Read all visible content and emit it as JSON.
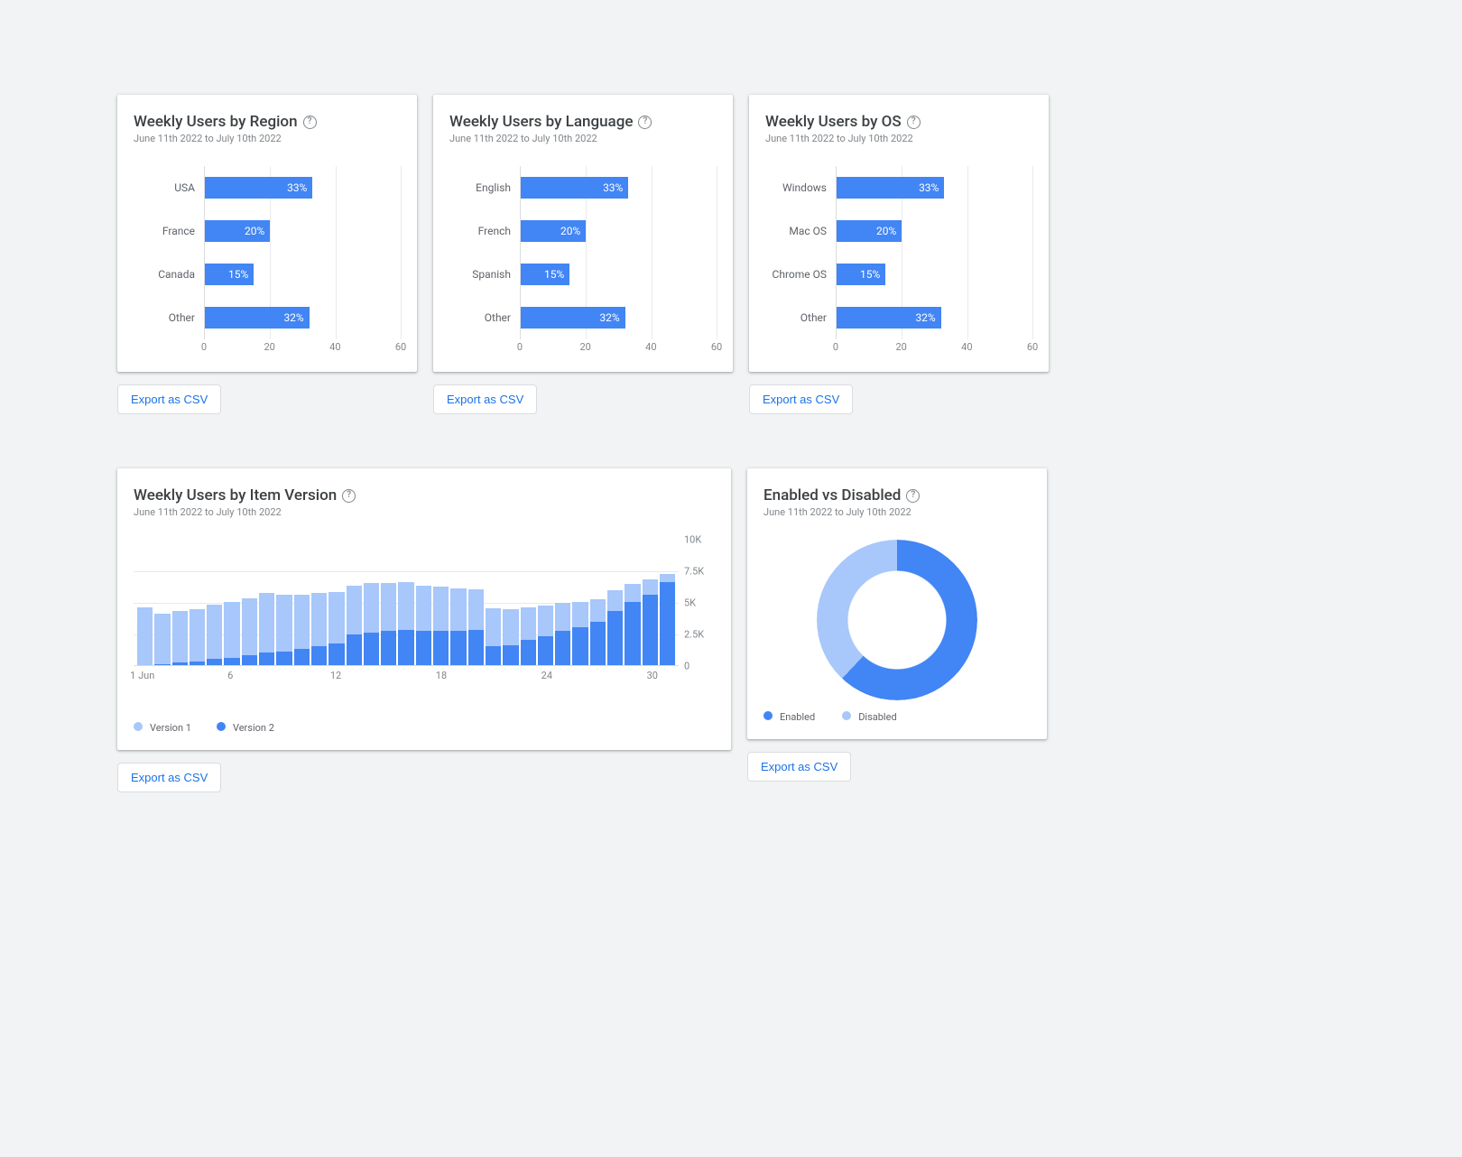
{
  "date_range": "June 11th 2022 to July 10th 2022",
  "export_label": "Export as CSV",
  "cards": {
    "region": {
      "title": "Weekly Users by Region"
    },
    "language": {
      "title": "Weekly Users by Language"
    },
    "os": {
      "title": "Weekly Users by OS"
    },
    "version": {
      "title": "Weekly Users by Item Version"
    },
    "enabled": {
      "title": "Enabled vs Disabled"
    }
  },
  "legend_version": {
    "v1": "Version 1",
    "v2": "Version 2"
  },
  "legend_enabled": {
    "enabled": "Enabled",
    "disabled": "Disabled"
  },
  "chart_data": [
    {
      "id": "region",
      "type": "bar",
      "orientation": "horizontal",
      "title": "Weekly Users by Region",
      "categories": [
        "USA",
        "France",
        "Canada",
        "Other"
      ],
      "values": [
        33,
        20,
        15,
        32
      ],
      "value_suffix": "%",
      "xlim": [
        0,
        60
      ],
      "xticks": [
        0,
        20,
        40,
        60
      ]
    },
    {
      "id": "language",
      "type": "bar",
      "orientation": "horizontal",
      "title": "Weekly Users by Language",
      "categories": [
        "English",
        "French",
        "Spanish",
        "Other"
      ],
      "values": [
        33,
        20,
        15,
        32
      ],
      "value_suffix": "%",
      "xlim": [
        0,
        60
      ],
      "xticks": [
        0,
        20,
        40,
        60
      ]
    },
    {
      "id": "os",
      "type": "bar",
      "orientation": "horizontal",
      "title": "Weekly Users by OS",
      "categories": [
        "Windows",
        "Mac OS",
        "Chrome OS",
        "Other"
      ],
      "values": [
        33,
        20,
        15,
        32
      ],
      "value_suffix": "%",
      "xlim": [
        0,
        60
      ],
      "xticks": [
        0,
        20,
        40,
        60
      ]
    },
    {
      "id": "version",
      "type": "bar",
      "orientation": "vertical",
      "stacked": true,
      "title": "Weekly Users by Item Version",
      "x": [
        1,
        2,
        3,
        4,
        5,
        6,
        7,
        8,
        9,
        10,
        11,
        12,
        13,
        14,
        15,
        16,
        17,
        18,
        19,
        20,
        21,
        22,
        23,
        24,
        25,
        26,
        27,
        28,
        29,
        30,
        31
      ],
      "series": [
        {
          "name": "Version 1",
          "color": "#a8c7fa",
          "values": [
            4600,
            4000,
            4100,
            4100,
            4300,
            4400,
            4500,
            4700,
            4500,
            4300,
            4200,
            4100,
            3900,
            3900,
            3800,
            3800,
            3600,
            3500,
            3400,
            3200,
            3000,
            2800,
            2600,
            2400,
            2200,
            2000,
            1800,
            1600,
            1400,
            1200,
            600
          ]
        },
        {
          "name": "Version 2",
          "color": "#4285f4",
          "values": [
            0,
            100,
            200,
            300,
            500,
            600,
            800,
            1000,
            1100,
            1300,
            1500,
            1700,
            2400,
            2600,
            2700,
            2800,
            2700,
            2700,
            2700,
            2800,
            1500,
            1600,
            2000,
            2300,
            2700,
            3000,
            3400,
            4300,
            5000,
            5600,
            6600
          ]
        }
      ],
      "ylim": [
        0,
        10000
      ],
      "yticks": [
        0,
        2500,
        5000,
        7500,
        10000
      ],
      "ytick_labels": [
        "0",
        "2.5K",
        "5K",
        "7.5K",
        "10K"
      ],
      "xtick_labels": {
        "1": "1 Jun",
        "6": "6",
        "12": "12",
        "18": "18",
        "24": "24",
        "30": "30"
      },
      "xlabel": "",
      "ylabel": ""
    },
    {
      "id": "enabled",
      "type": "pie",
      "donut": true,
      "title": "Enabled vs Disabled",
      "categories": [
        "Enabled",
        "Disabled"
      ],
      "values": [
        62,
        38
      ],
      "colors": [
        "#4285f4",
        "#a8c7fa"
      ]
    }
  ]
}
